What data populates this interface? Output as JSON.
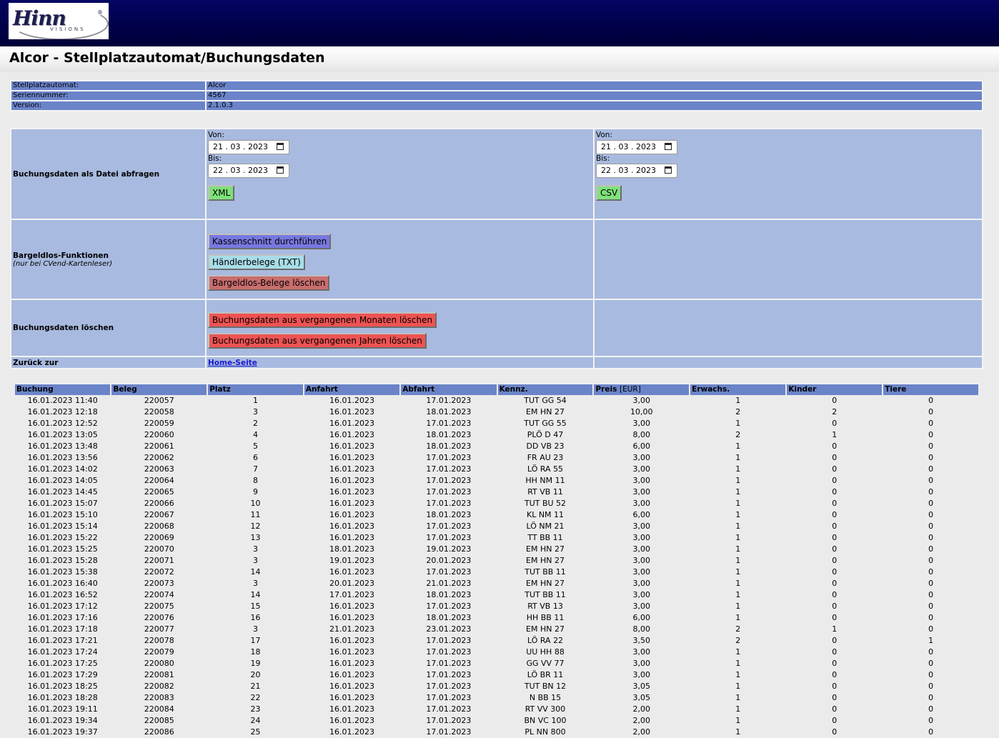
{
  "header": {
    "logo": {
      "brand": "Hinn",
      "sub": "VISIONS",
      "reg": "®"
    },
    "title": "Alcor - Stellplatzautomat/Buchungsdaten"
  },
  "info": [
    {
      "label": "Stellplatzautomat:",
      "value": "Alcor"
    },
    {
      "label": "Seriennummer:",
      "value": "4567"
    },
    {
      "label": "Version:",
      "value": "2.1.0.3"
    }
  ],
  "export": {
    "label": "Buchungsdaten als Datei abfragen",
    "xml": {
      "from_label": "Von:",
      "from": "21 . 03 . 2023",
      "to_label": "Bis:",
      "to": "22 . 03 . 2023",
      "button": "XML"
    },
    "csv": {
      "from_label": "Von:",
      "from": "21 . 03 . 2023",
      "to_label": "Bis:",
      "to": "22 . 03 . 2023",
      "button": "CSV"
    }
  },
  "cashless": {
    "label": "Bargeldlos-Funktionen",
    "note": "(nur bei CVend-Kartenleser)",
    "btn_kassenschnitt": "Kassenschnitt durchführen",
    "btn_haendler": "Händlerbelege (TXT)",
    "btn_loeschen": "Bargeldlos-Belege löschen"
  },
  "delete": {
    "label": "Buchungsdaten löschen",
    "btn_monate": "Buchungsdaten aus vergangenen Monaten löschen",
    "btn_jahre": "Buchungsdaten aus vergangenen Jahren löschen"
  },
  "back": {
    "label": "Zurück zur",
    "link": "Home-Seite"
  },
  "table": {
    "headers": [
      "Buchung",
      "Beleg",
      "Platz",
      "Anfahrt",
      "Abfahrt",
      "Kennz.",
      "Preis",
      "Erwachs.",
      "Kinder",
      "Tiere"
    ],
    "price_unit": "[EUR]",
    "rows": [
      [
        "16.01.2023 11:40",
        "220057",
        "1",
        "16.01.2023",
        "17.01.2023",
        "TUT GG 54",
        "3,00",
        "1",
        "0",
        "0"
      ],
      [
        "16.01.2023 12:18",
        "220058",
        "3",
        "16.01.2023",
        "18.01.2023",
        "EM HN 27",
        "10,00",
        "2",
        "2",
        "0"
      ],
      [
        "16.01.2023 12:52",
        "220059",
        "2",
        "16.01.2023",
        "17.01.2023",
        "TUT GG 55",
        "3,00",
        "1",
        "0",
        "0"
      ],
      [
        "16.01.2023 13:05",
        "220060",
        "4",
        "16.01.2023",
        "18.01.2023",
        "PLÖ D 47",
        "8,00",
        "2",
        "1",
        "0"
      ],
      [
        "16.01.2023 13:48",
        "220061",
        "5",
        "16.01.2023",
        "18.01.2023",
        "DD VB 23",
        "6,00",
        "1",
        "0",
        "0"
      ],
      [
        "16.01.2023 13:56",
        "220062",
        "6",
        "16.01.2023",
        "17.01.2023",
        "FR AU 23",
        "3,00",
        "1",
        "0",
        "0"
      ],
      [
        "16.01.2023 14:02",
        "220063",
        "7",
        "16.01.2023",
        "17.01.2023",
        "LÖ RA 55",
        "3,00",
        "1",
        "0",
        "0"
      ],
      [
        "16.01.2023 14:05",
        "220064",
        "8",
        "16.01.2023",
        "17.01.2023",
        "HH NM 11",
        "3,00",
        "1",
        "0",
        "0"
      ],
      [
        "16.01.2023 14:45",
        "220065",
        "9",
        "16.01.2023",
        "17.01.2023",
        "RT VB 11",
        "3,00",
        "1",
        "0",
        "0"
      ],
      [
        "16.01.2023 15:07",
        "220066",
        "10",
        "16.01.2023",
        "17.01.2023",
        "TUT BU 52",
        "3,00",
        "1",
        "0",
        "0"
      ],
      [
        "16.01.2023 15:10",
        "220067",
        "11",
        "16.01.2023",
        "18.01.2023",
        "KL NM 11",
        "6,00",
        "1",
        "0",
        "0"
      ],
      [
        "16.01.2023 15:14",
        "220068",
        "12",
        "16.01.2023",
        "17.01.2023",
        "LÖ NM 21",
        "3,00",
        "1",
        "0",
        "0"
      ],
      [
        "16.01.2023 15:22",
        "220069",
        "13",
        "16.01.2023",
        "17.01.2023",
        "TT BB 11",
        "3,00",
        "1",
        "0",
        "0"
      ],
      [
        "16.01.2023 15:25",
        "220070",
        "3",
        "18.01.2023",
        "19.01.2023",
        "EM HN 27",
        "3,00",
        "1",
        "0",
        "0"
      ],
      [
        "16.01.2023 15:28",
        "220071",
        "3",
        "19.01.2023",
        "20.01.2023",
        "EM HN 27",
        "3,00",
        "1",
        "0",
        "0"
      ],
      [
        "16.01.2023 15:38",
        "220072",
        "14",
        "16.01.2023",
        "17.01.2023",
        "TUT BB 11",
        "3,00",
        "1",
        "0",
        "0"
      ],
      [
        "16.01.2023 16:40",
        "220073",
        "3",
        "20.01.2023",
        "21.01.2023",
        "EM HN 27",
        "3,00",
        "1",
        "0",
        "0"
      ],
      [
        "16.01.2023 16:52",
        "220074",
        "14",
        "17.01.2023",
        "18.01.2023",
        "TUT BB 11",
        "3,00",
        "1",
        "0",
        "0"
      ],
      [
        "16.01.2023 17:12",
        "220075",
        "15",
        "16.01.2023",
        "17.01.2023",
        "RT VB 13",
        "3,00",
        "1",
        "0",
        "0"
      ],
      [
        "16.01.2023 17:16",
        "220076",
        "16",
        "16.01.2023",
        "18.01.2023",
        "HH BB 11",
        "6,00",
        "1",
        "0",
        "0"
      ],
      [
        "16.01.2023 17:18",
        "220077",
        "3",
        "21.01.2023",
        "23.01.2023",
        "EM HN 27",
        "8,00",
        "2",
        "1",
        "0"
      ],
      [
        "16.01.2023 17:21",
        "220078",
        "17",
        "16.01.2023",
        "17.01.2023",
        "LÖ RA 22",
        "3,50",
        "2",
        "0",
        "1"
      ],
      [
        "16.01.2023 17:24",
        "220079",
        "18",
        "16.01.2023",
        "17.01.2023",
        "UU HH 88",
        "3,00",
        "1",
        "0",
        "0"
      ],
      [
        "16.01.2023 17:25",
        "220080",
        "19",
        "16.01.2023",
        "17.01.2023",
        "GG VV 77",
        "3,00",
        "1",
        "0",
        "0"
      ],
      [
        "16.01.2023 17:29",
        "220081",
        "20",
        "16.01.2023",
        "17.01.2023",
        "LÖ BR 11",
        "3,00",
        "1",
        "0",
        "0"
      ],
      [
        "16.01.2023 18:25",
        "220082",
        "21",
        "16.01.2023",
        "17.01.2023",
        "TUT BN 12",
        "3,05",
        "1",
        "0",
        "0"
      ],
      [
        "16.01.2023 18:28",
        "220083",
        "22",
        "16.01.2023",
        "17.01.2023",
        "N BB 15",
        "3,05",
        "1",
        "0",
        "0"
      ],
      [
        "16.01.2023 19:11",
        "220084",
        "23",
        "16.01.2023",
        "17.01.2023",
        "RT VV 300",
        "2,00",
        "1",
        "0",
        "0"
      ],
      [
        "16.01.2023 19:34",
        "220085",
        "24",
        "16.01.2023",
        "17.01.2023",
        "BN VC 100",
        "2,00",
        "1",
        "0",
        "0"
      ],
      [
        "16.01.2023 19:37",
        "220086",
        "25",
        "16.01.2023",
        "17.01.2023",
        "PL NN 800",
        "2,00",
        "1",
        "0",
        "0"
      ]
    ]
  }
}
